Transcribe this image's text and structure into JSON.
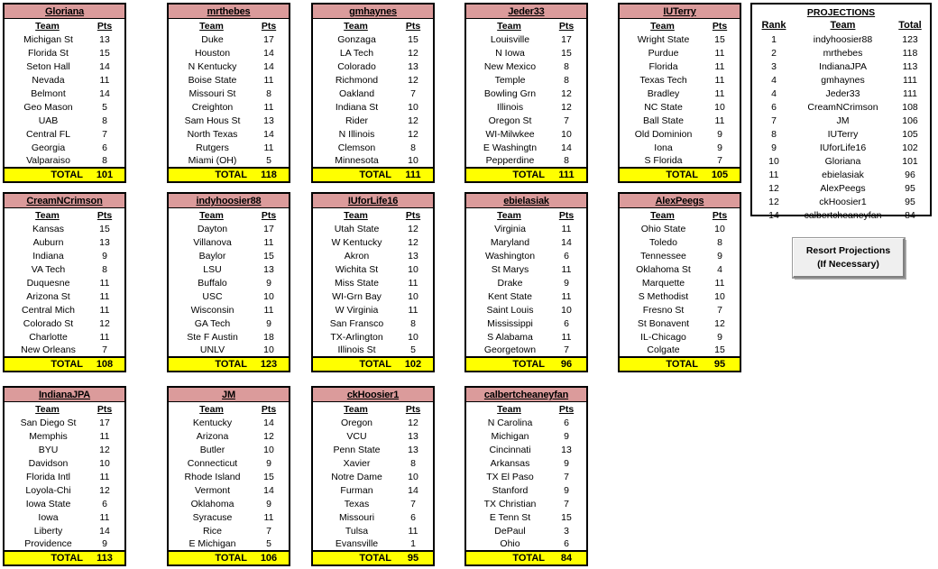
{
  "rosters": [
    {
      "owner": "Gloriana",
      "col_team": "Team",
      "col_pts": "Pts",
      "total_label": "TOTAL",
      "total": "101",
      "rows": [
        {
          "team": "Michigan St",
          "pts": "13"
        },
        {
          "team": "Florida St",
          "pts": "15"
        },
        {
          "team": "Seton Hall",
          "pts": "14"
        },
        {
          "team": "Nevada",
          "pts": "11"
        },
        {
          "team": "Belmont",
          "pts": "14"
        },
        {
          "team": "Geo Mason",
          "pts": "5"
        },
        {
          "team": "UAB",
          "pts": "8"
        },
        {
          "team": "Central FL",
          "pts": "7"
        },
        {
          "team": "Georgia",
          "pts": "6"
        },
        {
          "team": "Valparaiso",
          "pts": "8"
        }
      ]
    },
    {
      "owner": "mrthebes",
      "col_team": "Team",
      "col_pts": "Pts",
      "total_label": "TOTAL",
      "total": "118",
      "rows": [
        {
          "team": "Duke",
          "pts": "17"
        },
        {
          "team": "Houston",
          "pts": "14"
        },
        {
          "team": "N Kentucky",
          "pts": "14"
        },
        {
          "team": "Boise State",
          "pts": "11"
        },
        {
          "team": "Missouri St",
          "pts": "8"
        },
        {
          "team": "Creighton",
          "pts": "11"
        },
        {
          "team": "Sam Hous St",
          "pts": "13"
        },
        {
          "team": "North Texas",
          "pts": "14"
        },
        {
          "team": "Rutgers",
          "pts": "11"
        },
        {
          "team": "Miami (OH)",
          "pts": "5"
        }
      ]
    },
    {
      "owner": "gmhaynes",
      "col_team": "Team",
      "col_pts": "Pts",
      "total_label": "TOTAL",
      "total": "111",
      "rows": [
        {
          "team": "Gonzaga",
          "pts": "15"
        },
        {
          "team": "LA Tech",
          "pts": "12"
        },
        {
          "team": "Colorado",
          "pts": "13"
        },
        {
          "team": "Richmond",
          "pts": "12"
        },
        {
          "team": "Oakland",
          "pts": "7"
        },
        {
          "team": "Indiana St",
          "pts": "10"
        },
        {
          "team": "Rider",
          "pts": "12"
        },
        {
          "team": "N Illinois",
          "pts": "12"
        },
        {
          "team": "Clemson",
          "pts": "8"
        },
        {
          "team": "Minnesota",
          "pts": "10"
        }
      ]
    },
    {
      "owner": "Jeder33",
      "col_team": "Team",
      "col_pts": "Pts",
      "total_label": "TOTAL",
      "total": "111",
      "rows": [
        {
          "team": "Louisville",
          "pts": "17"
        },
        {
          "team": "N Iowa",
          "pts": "15"
        },
        {
          "team": "New Mexico",
          "pts": "8"
        },
        {
          "team": "Temple",
          "pts": "8"
        },
        {
          "team": "Bowling Grn",
          "pts": "12"
        },
        {
          "team": "Illinois",
          "pts": "12"
        },
        {
          "team": "Oregon St",
          "pts": "7"
        },
        {
          "team": "WI-Milwkee",
          "pts": "10"
        },
        {
          "team": "E Washingtn",
          "pts": "14"
        },
        {
          "team": "Pepperdine",
          "pts": "8"
        }
      ]
    },
    {
      "owner": "IUTerry",
      "col_team": "Team",
      "col_pts": "Pts",
      "total_label": "TOTAL",
      "total": "105",
      "rows": [
        {
          "team": "Wright State",
          "pts": "15"
        },
        {
          "team": "Purdue",
          "pts": "11"
        },
        {
          "team": "Florida",
          "pts": "11"
        },
        {
          "team": "Texas Tech",
          "pts": "11"
        },
        {
          "team": "Bradley",
          "pts": "11"
        },
        {
          "team": "NC State",
          "pts": "10"
        },
        {
          "team": "Ball State",
          "pts": "11"
        },
        {
          "team": "Old Dominion",
          "pts": "9"
        },
        {
          "team": "Iona",
          "pts": "9"
        },
        {
          "team": "S Florida",
          "pts": "7"
        }
      ]
    },
    {
      "owner": "CreamNCrimson",
      "col_team": "Team",
      "col_pts": "Pts",
      "total_label": "TOTAL",
      "total": "108",
      "rows": [
        {
          "team": "Kansas",
          "pts": "15"
        },
        {
          "team": "Auburn",
          "pts": "13"
        },
        {
          "team": "Indiana",
          "pts": "9"
        },
        {
          "team": "VA Tech",
          "pts": "8"
        },
        {
          "team": "Duquesne",
          "pts": "11"
        },
        {
          "team": "Arizona St",
          "pts": "11"
        },
        {
          "team": "Central Mich",
          "pts": "11"
        },
        {
          "team": "Colorado St",
          "pts": "12"
        },
        {
          "team": "Charlotte",
          "pts": "11"
        },
        {
          "team": "New Orleans",
          "pts": "7"
        }
      ]
    },
    {
      "owner": "indyhoosier88",
      "col_team": "Team",
      "col_pts": "Pts",
      "total_label": "TOTAL",
      "total": "123",
      "rows": [
        {
          "team": "Dayton",
          "pts": "17"
        },
        {
          "team": "Villanova",
          "pts": "11"
        },
        {
          "team": "Baylor",
          "pts": "15"
        },
        {
          "team": "LSU",
          "pts": "13"
        },
        {
          "team": "Buffalo",
          "pts": "9"
        },
        {
          "team": "USC",
          "pts": "10"
        },
        {
          "team": "Wisconsin",
          "pts": "11"
        },
        {
          "team": "GA Tech",
          "pts": "9"
        },
        {
          "team": "Ste F Austin",
          "pts": "18"
        },
        {
          "team": "UNLV",
          "pts": "10"
        }
      ]
    },
    {
      "owner": "IUforLife16",
      "col_team": "Team",
      "col_pts": "Pts",
      "total_label": "TOTAL",
      "total": "102",
      "rows": [
        {
          "team": "Utah State",
          "pts": "12"
        },
        {
          "team": "W Kentucky",
          "pts": "12"
        },
        {
          "team": "Akron",
          "pts": "13"
        },
        {
          "team": "Wichita St",
          "pts": "10"
        },
        {
          "team": "Miss State",
          "pts": "11"
        },
        {
          "team": "WI-Grn Bay",
          "pts": "10"
        },
        {
          "team": "W Virginia",
          "pts": "11"
        },
        {
          "team": "San Fransco",
          "pts": "8"
        },
        {
          "team": "TX-Arlington",
          "pts": "10"
        },
        {
          "team": "Illinois St",
          "pts": "5"
        }
      ]
    },
    {
      "owner": "ebielasiak",
      "col_team": "Team",
      "col_pts": "Pts",
      "total_label": "TOTAL",
      "total": "96",
      "rows": [
        {
          "team": "Virginia",
          "pts": "11"
        },
        {
          "team": "Maryland",
          "pts": "14"
        },
        {
          "team": "Washington",
          "pts": "6"
        },
        {
          "team": "St Marys",
          "pts": "11"
        },
        {
          "team": "Drake",
          "pts": "9"
        },
        {
          "team": "Kent State",
          "pts": "11"
        },
        {
          "team": "Saint Louis",
          "pts": "10"
        },
        {
          "team": "Mississippi",
          "pts": "6"
        },
        {
          "team": "S Alabama",
          "pts": "11"
        },
        {
          "team": "Georgetown",
          "pts": "7"
        }
      ]
    },
    {
      "owner": "AlexPeegs",
      "col_team": "Team",
      "col_pts": "Pts",
      "total_label": "TOTAL",
      "total": "95",
      "rows": [
        {
          "team": "Ohio State",
          "pts": "10"
        },
        {
          "team": "Toledo",
          "pts": "8"
        },
        {
          "team": "Tennessee",
          "pts": "9"
        },
        {
          "team": "Oklahoma St",
          "pts": "4"
        },
        {
          "team": "Marquette",
          "pts": "11"
        },
        {
          "team": "S Methodist",
          "pts": "10"
        },
        {
          "team": "Fresno St",
          "pts": "7"
        },
        {
          "team": "St Bonavent",
          "pts": "12"
        },
        {
          "team": "IL-Chicago",
          "pts": "9"
        },
        {
          "team": "Colgate",
          "pts": "15"
        }
      ]
    },
    {
      "owner": "IndianaJPA",
      "col_team": "Team",
      "col_pts": "Pts",
      "total_label": "TOTAL",
      "total": "113",
      "rows": [
        {
          "team": "San Diego St",
          "pts": "17"
        },
        {
          "team": "Memphis",
          "pts": "11"
        },
        {
          "team": "BYU",
          "pts": "12"
        },
        {
          "team": "Davidson",
          "pts": "10"
        },
        {
          "team": "Florida Intl",
          "pts": "11"
        },
        {
          "team": "Loyola-Chi",
          "pts": "12"
        },
        {
          "team": "Iowa State",
          "pts": "6"
        },
        {
          "team": "Iowa",
          "pts": "11"
        },
        {
          "team": "Liberty",
          "pts": "14"
        },
        {
          "team": "Providence",
          "pts": "9"
        }
      ]
    },
    {
      "owner": "JM",
      "col_team": "Team",
      "col_pts": "Pts",
      "total_label": "TOTAL",
      "total": "106",
      "rows": [
        {
          "team": "Kentucky",
          "pts": "14"
        },
        {
          "team": "Arizona",
          "pts": "12"
        },
        {
          "team": "Butler",
          "pts": "10"
        },
        {
          "team": "Connecticut",
          "pts": "9"
        },
        {
          "team": "Rhode Island",
          "pts": "15"
        },
        {
          "team": "Vermont",
          "pts": "14"
        },
        {
          "team": "Oklahoma",
          "pts": "9"
        },
        {
          "team": "Syracuse",
          "pts": "11"
        },
        {
          "team": "Rice",
          "pts": "7"
        },
        {
          "team": "E Michigan",
          "pts": "5"
        }
      ]
    },
    {
      "owner": "ckHoosier1",
      "col_team": "Team",
      "col_pts": "Pts",
      "total_label": "TOTAL",
      "total": "95",
      "rows": [
        {
          "team": "Oregon",
          "pts": "12"
        },
        {
          "team": "VCU",
          "pts": "13"
        },
        {
          "team": "Penn State",
          "pts": "13"
        },
        {
          "team": "Xavier",
          "pts": "8"
        },
        {
          "team": "Notre Dame",
          "pts": "10"
        },
        {
          "team": "Furman",
          "pts": "14"
        },
        {
          "team": "Texas",
          "pts": "7"
        },
        {
          "team": "Missouri",
          "pts": "6"
        },
        {
          "team": "Tulsa",
          "pts": "11"
        },
        {
          "team": "Evansville",
          "pts": "1"
        }
      ]
    },
    {
      "owner": "calbertcheaneyfan",
      "col_team": "Team",
      "col_pts": "Pts",
      "total_label": "TOTAL",
      "total": "84",
      "rows": [
        {
          "team": "N Carolina",
          "pts": "6"
        },
        {
          "team": "Michigan",
          "pts": "9"
        },
        {
          "team": "Cincinnati",
          "pts": "13"
        },
        {
          "team": "Arkansas",
          "pts": "9"
        },
        {
          "team": "TX El Paso",
          "pts": "7"
        },
        {
          "team": "Stanford",
          "pts": "9"
        },
        {
          "team": "TX Christian",
          "pts": "7"
        },
        {
          "team": "E Tenn St",
          "pts": "15"
        },
        {
          "team": "DePaul",
          "pts": "3"
        },
        {
          "team": "Ohio",
          "pts": "6"
        }
      ]
    }
  ],
  "projections": {
    "title": "PROJECTIONS",
    "columns": {
      "rank": "Rank",
      "team": "Team",
      "total": "Total"
    },
    "rows": [
      {
        "rank": "1",
        "team": "indyhoosier88",
        "total": "123"
      },
      {
        "rank": "2",
        "team": "mrthebes",
        "total": "118"
      },
      {
        "rank": "3",
        "team": "IndianaJPA",
        "total": "113"
      },
      {
        "rank": "4",
        "team": "gmhaynes",
        "total": "111"
      },
      {
        "rank": "4",
        "team": "Jeder33",
        "total": "111"
      },
      {
        "rank": "6",
        "team": "CreamNCrimson",
        "total": "108"
      },
      {
        "rank": "7",
        "team": "JM",
        "total": "106"
      },
      {
        "rank": "8",
        "team": "IUTerry",
        "total": "105"
      },
      {
        "rank": "9",
        "team": "IUforLife16",
        "total": "102"
      },
      {
        "rank": "10",
        "team": "Gloriana",
        "total": "101"
      },
      {
        "rank": "11",
        "team": "ebielasiak",
        "total": "96"
      },
      {
        "rank": "12",
        "team": "AlexPeegs",
        "total": "95"
      },
      {
        "rank": "12",
        "team": "ckHoosier1",
        "total": "95"
      },
      {
        "rank": "14",
        "team": "calbertcheaneyfan",
        "total": "84"
      }
    ]
  },
  "resort_button": {
    "line1": "Resort Projections",
    "line2": "(If Necessary)"
  },
  "colors": {
    "owner_header": "#DB9B9B",
    "total_row": "#FFFF00",
    "border": "#000000",
    "button_face": "#EFEFEF"
  }
}
